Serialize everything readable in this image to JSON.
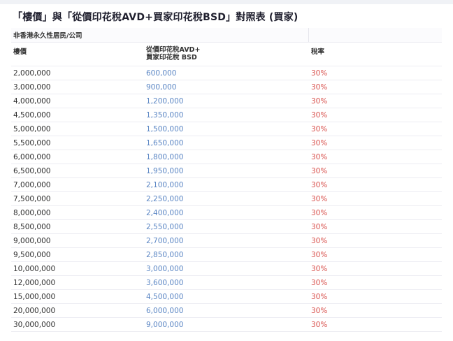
{
  "title": "「樓價」與「從價印花稅AVD+買家印花稅BSD」對照表 (買家)",
  "category": "非香港永久性居民/公司",
  "headers": {
    "price": "樓價",
    "stamp_line1": "從價印花稅AVD+",
    "stamp_line2": "買家印花稅 BSD",
    "rate": "稅率"
  },
  "rows": [
    {
      "price": "2,000,000",
      "stamp": "600,000",
      "rate": "30%"
    },
    {
      "price": "3,000,000",
      "stamp": "900,000",
      "rate": "30%"
    },
    {
      "price": "4,000,000",
      "stamp": "1,200,000",
      "rate": "30%"
    },
    {
      "price": "4,500,000",
      "stamp": "1,350,000",
      "rate": "30%"
    },
    {
      "price": "5,000,000",
      "stamp": "1,500,000",
      "rate": "30%"
    },
    {
      "price": "5,500,000",
      "stamp": "1,650,000",
      "rate": "30%"
    },
    {
      "price": "6,000,000",
      "stamp": "1,800,000",
      "rate": "30%"
    },
    {
      "price": "6,500,000",
      "stamp": "1,950,000",
      "rate": "30%"
    },
    {
      "price": "7,000,000",
      "stamp": "2,100,000",
      "rate": "30%"
    },
    {
      "price": "7,500,000",
      "stamp": "2,250,000",
      "rate": "30%"
    },
    {
      "price": "8,000,000",
      "stamp": "2,400,000",
      "rate": "30%"
    },
    {
      "price": "8,500,000",
      "stamp": "2,550,000",
      "rate": "30%"
    },
    {
      "price": "9,000,000",
      "stamp": "2,700,000",
      "rate": "30%"
    },
    {
      "price": "9,500,000",
      "stamp": "2,850,000",
      "rate": "30%"
    },
    {
      "price": "10,000,000",
      "stamp": "3,000,000",
      "rate": "30%"
    },
    {
      "price": "12,000,000",
      "stamp": "3,600,000",
      "rate": "30%"
    },
    {
      "price": "15,000,000",
      "stamp": "4,500,000",
      "rate": "30%"
    },
    {
      "price": "20,000,000",
      "stamp": "6,000,000",
      "rate": "30%"
    },
    {
      "price": "30,000,000",
      "stamp": "9,000,000",
      "rate": "30%"
    }
  ],
  "colors": {
    "stamp_value": "#5b86c4",
    "rate_value": "#d9534f"
  }
}
